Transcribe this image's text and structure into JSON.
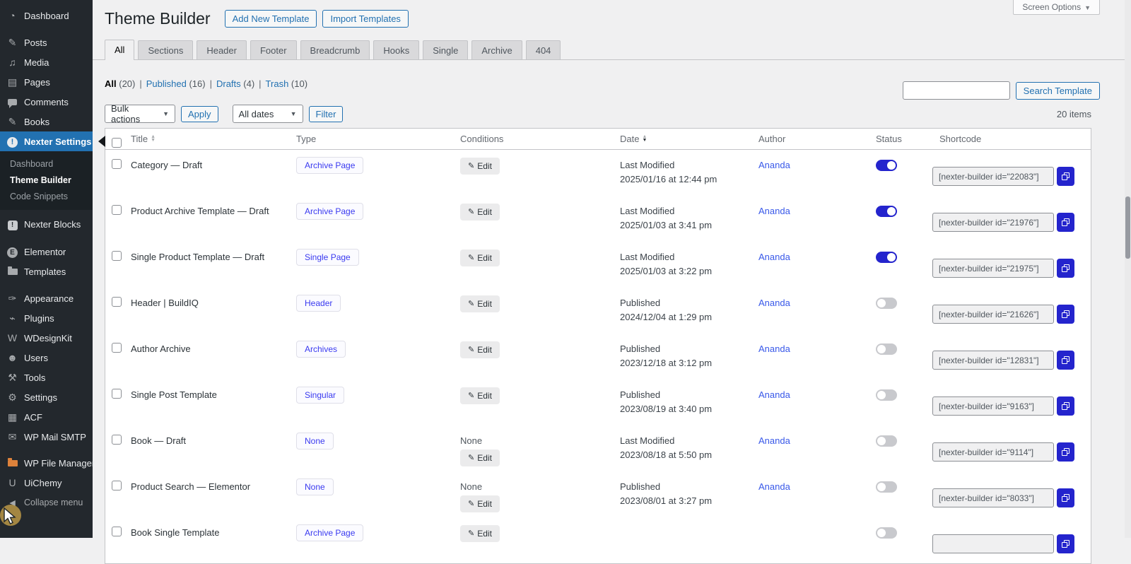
{
  "colors": {
    "accent_blue": "#2271b1",
    "toggle_indigo": "#2424cd",
    "link_indigo": "#3858e9",
    "sidebar_bg": "#23282d",
    "page_bg": "#f0f0f1",
    "badge_text": "#3a3af0"
  },
  "sidebar": {
    "items": [
      {
        "label": "Dashboard",
        "icon": "dashboard-icon",
        "glyph": "◔"
      },
      {
        "label": "Posts",
        "icon": "pushpin-icon",
        "glyph": "✎",
        "gap": "gap10"
      },
      {
        "label": "Media",
        "icon": "media-icon",
        "glyph": "♫"
      },
      {
        "label": "Pages",
        "icon": "pages-icon",
        "glyph": "▤"
      },
      {
        "label": "Comments",
        "icon": "comment-bubble-icon",
        "glyph": "bubble"
      },
      {
        "label": "Books",
        "icon": "pushpin-icon",
        "glyph": "✎"
      },
      {
        "label": "Nexter Settings",
        "icon": "nexter-settings-icon",
        "glyph": "nx",
        "active": true
      },
      {
        "submenu": [
          {
            "label": "Dashboard"
          },
          {
            "label": "Theme Builder",
            "current": true
          },
          {
            "label": "Code Snippets"
          }
        ]
      },
      {
        "label": "Nexter Blocks",
        "icon": "nexter-blocks-icon",
        "glyph": "nb",
        "gap": "gap6"
      },
      {
        "label": "Elementor",
        "icon": "elementor-icon",
        "glyph": "el",
        "gap": "gap11"
      },
      {
        "label": "Templates",
        "icon": "folder-icon",
        "glyph": "folder"
      },
      {
        "label": "Appearance",
        "icon": "appearance-brush-icon",
        "glyph": "✑",
        "gap": "gap10"
      },
      {
        "label": "Plugins",
        "icon": "plugin-icon",
        "glyph": "⌁"
      },
      {
        "label": "WDesignKit",
        "icon": "wdesignkit-icon",
        "glyph": "W"
      },
      {
        "label": "Users",
        "icon": "users-icon",
        "glyph": "☻"
      },
      {
        "label": "Tools",
        "icon": "tools-icon",
        "glyph": "⚒"
      },
      {
        "label": "Settings",
        "icon": "settings-icon",
        "glyph": "⚙"
      },
      {
        "label": "ACF",
        "icon": "acf-grid-icon",
        "glyph": "▦"
      },
      {
        "label": "WP Mail SMTP",
        "icon": "mail-icon",
        "glyph": "✉"
      },
      {
        "label": "WP File Manager",
        "icon": "file-manager-folder-icon",
        "glyph": "folder-orange",
        "gap": "gap9"
      },
      {
        "label": "UiChemy",
        "icon": "uichemy-icon",
        "glyph": "U"
      },
      {
        "label": "Collapse menu",
        "icon": "collapse-arrow-icon",
        "glyph": "◄",
        "collapse": true
      }
    ]
  },
  "header": {
    "title": "Theme Builder",
    "add_label": "Add New Template",
    "import_label": "Import Templates",
    "screen_options": "Screen Options",
    "screen_options_caret": "▼"
  },
  "tabs": {
    "active": "All",
    "items": [
      "All",
      "Sections",
      "Header",
      "Footer",
      "Breadcrumb",
      "Hooks",
      "Single",
      "Archive",
      "404"
    ]
  },
  "filters": {
    "links": [
      {
        "label": "All",
        "count": "(20)",
        "current": true
      },
      {
        "label": "Published",
        "count": "(16)"
      },
      {
        "label": "Drafts",
        "count": "(4)"
      },
      {
        "label": "Trash",
        "count": "(10)"
      }
    ],
    "separator": "|"
  },
  "toolbar": {
    "bulk_actions": "Bulk actions",
    "apply": "Apply",
    "all_dates": "All dates",
    "filter": "Filter",
    "items_count": "20 items"
  },
  "search": {
    "value": "",
    "button": "Search Template"
  },
  "table": {
    "columns": [
      {
        "label": "Title",
        "sort": "both"
      },
      {
        "label": "Type"
      },
      {
        "label": "Conditions"
      },
      {
        "label": "Date",
        "sort": "desc"
      },
      {
        "label": "Author"
      },
      {
        "label": "Status"
      },
      {
        "label": "Shortcode"
      }
    ],
    "edit_label": "Edit",
    "rows": [
      {
        "title": "Category — Draft",
        "type": "Archive Page",
        "cond_none": false,
        "date_label": "Last Modified",
        "date_value": "2025/01/16 at 12:44 pm",
        "author": "Ananda",
        "status_on": true,
        "shortcode": "[nexter-builder id=\"22083\"]"
      },
      {
        "title": "Product Archive Template — Draft",
        "type": "Archive Page",
        "cond_none": false,
        "date_label": "Last Modified",
        "date_value": "2025/01/03 at 3:41 pm",
        "author": "Ananda",
        "status_on": true,
        "shortcode": "[nexter-builder id=\"21976\"]"
      },
      {
        "title": "Single Product Template — Draft",
        "type": "Single Page",
        "cond_none": false,
        "date_label": "Last Modified",
        "date_value": "2025/01/03 at 3:22 pm",
        "author": "Ananda",
        "status_on": true,
        "shortcode": "[nexter-builder id=\"21975\"]"
      },
      {
        "title": "Header | BuildIQ",
        "type": "Header",
        "cond_none": false,
        "date_label": "Published",
        "date_value": "2024/12/04 at 1:29 pm",
        "author": "Ananda",
        "status_on": false,
        "shortcode": "[nexter-builder id=\"21626\"]"
      },
      {
        "title": "Author Archive",
        "type": "Archives",
        "cond_none": false,
        "date_label": "Published",
        "date_value": "2023/12/18 at 3:12 pm",
        "author": "Ananda",
        "status_on": false,
        "shortcode": "[nexter-builder id=\"12831\"]"
      },
      {
        "title": "Single Post Template",
        "type": "Singular",
        "cond_none": false,
        "date_label": "Published",
        "date_value": "2023/08/19 at 3:40 pm",
        "author": "Ananda",
        "status_on": false,
        "shortcode": "[nexter-builder id=\"9163\"]"
      },
      {
        "title": "Book — Draft",
        "type": "None",
        "cond_none": true,
        "date_label": "Last Modified",
        "date_value": "2023/08/18 at 5:50 pm",
        "author": "Ananda",
        "status_on": false,
        "shortcode": "[nexter-builder id=\"9114\"]"
      },
      {
        "title": "Product Search — Elementor",
        "type": "None",
        "cond_none": true,
        "date_label": "Published",
        "date_value": "2023/08/01 at 3:27 pm",
        "author": "Ananda",
        "status_on": false,
        "shortcode": "[nexter-builder id=\"8033\"]"
      },
      {
        "title": "Book Single Template",
        "type": "Archive Page",
        "cond_none": false,
        "date_label": "",
        "date_value": "",
        "author": "",
        "status_on": false,
        "shortcode": "",
        "partial": true
      }
    ]
  }
}
